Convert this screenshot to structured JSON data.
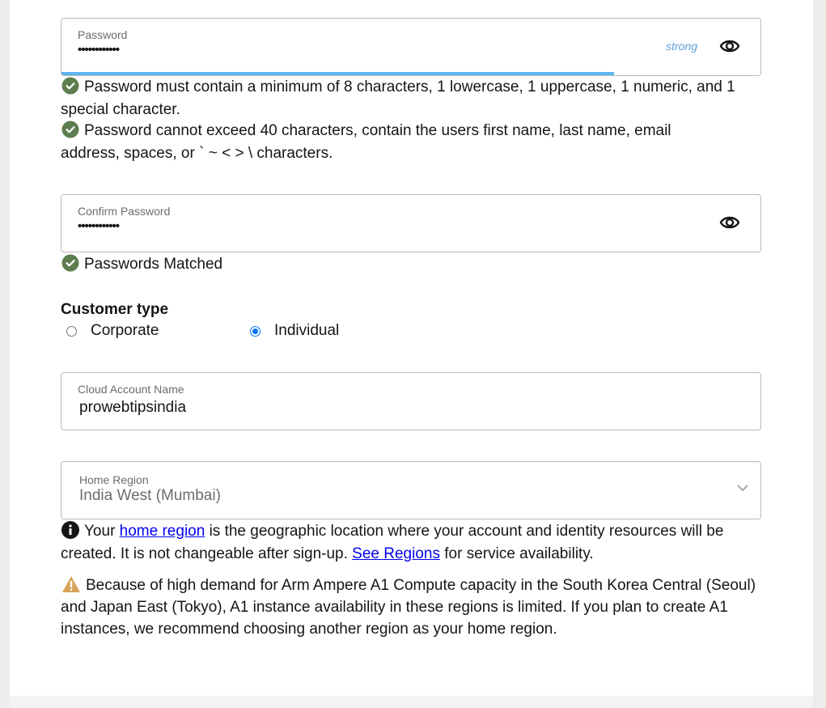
{
  "password": {
    "label": "Password",
    "masked_value": "••••••••••••",
    "strength_label": "strong",
    "strength_fraction": 0.79,
    "strength_color": "#5cb3f0",
    "toggle_icon": "eye-icon"
  },
  "password_rules": [
    {
      "icon": "check-circle-icon",
      "text": "Password must contain a minimum of 8 characters, 1 lowercase, 1 uppercase, 1 numeric, and 1 special character."
    },
    {
      "icon": "check-circle-icon",
      "text": "Password cannot exceed 40 characters, contain the users first name, last name, email address, spaces, or ` ~ < > \\ characters."
    }
  ],
  "confirm_password": {
    "label": "Confirm Password",
    "masked_value": "••••••••••••",
    "toggle_icon": "eye-icon",
    "match_message": "Passwords Matched"
  },
  "customer_type": {
    "heading": "Customer type",
    "options": [
      {
        "label": "Corporate",
        "checked": false
      },
      {
        "label": "Individual",
        "checked": true
      }
    ]
  },
  "cloud_account": {
    "label": "Cloud Account Name",
    "value": "prowebtipsindia"
  },
  "home_region": {
    "label": "Home Region",
    "value": "India West (Mumbai)",
    "info": {
      "before_link": "Your ",
      "link1": "home region",
      "middle": " is the geographic location where your account and identity resources will be created. It is not changeable after sign-up. ",
      "link2": "See Regions",
      "after": " for service availability."
    },
    "warning": "Because of high demand for Arm Ampere A1 Compute capacity in the South Korea Central (Seoul) and Japan East (Tokyo), A1 instance availability in these regions is limited. If you plan to create A1 instances, we recommend choosing another region as your home region."
  },
  "colors": {
    "success": "#5d7d4f",
    "warning": "#d9a35c",
    "link": "#0000ee",
    "radio_accent": "#0075ff"
  }
}
